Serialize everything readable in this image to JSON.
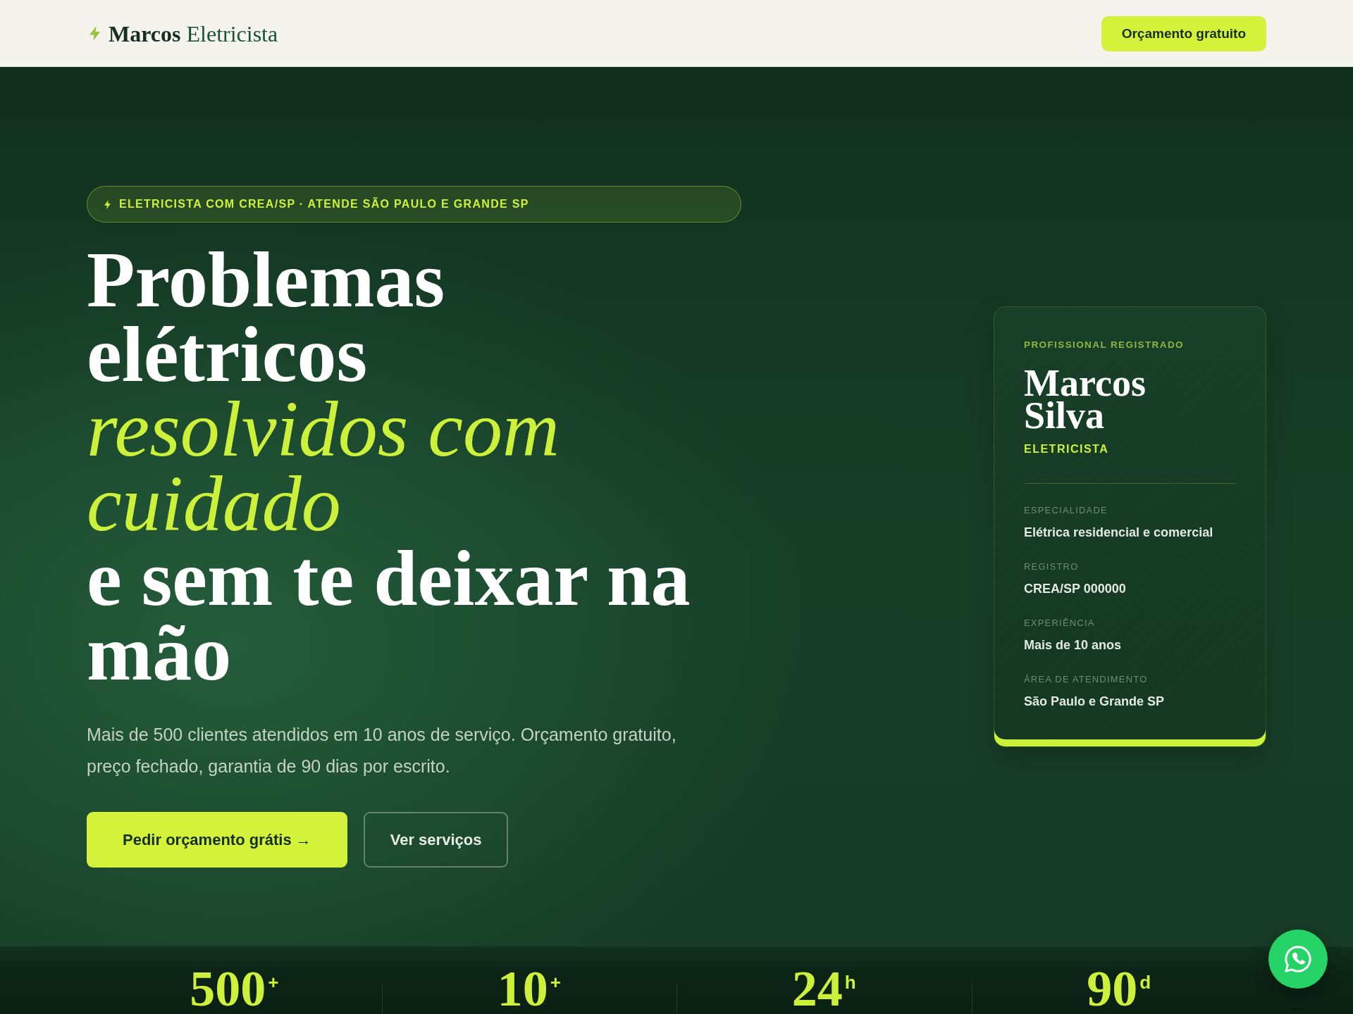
{
  "header": {
    "logo": {
      "first": "Marcos",
      "second": "Eletricista"
    },
    "cta": "Orçamento gratuito"
  },
  "hero": {
    "badge": "ELETRICISTA COM CREA/SP · ATENDE SÃO PAULO E GRANDE SP",
    "heading": "Problemas elétricos *resolvidos com cuidado* e sem te deixar na mão",
    "description": "Mais de 500 clientes atendidos em 10 anos de serviço. Orçamento gratuito, preço fechado, garantia de 90 dias por escrito.",
    "buttons": [
      {
        "label": "Pedir orçamento grátis →",
        "kind": "primary"
      },
      {
        "label": "Ver serviços",
        "kind": "outline"
      }
    ]
  },
  "profile_card": {
    "eyebrow": "PROFISSIONAL REGISTRADO",
    "name": "Marcos Silva",
    "role": "ELETRICISTA",
    "details": [
      {
        "label": "ESPECIALIDADE",
        "value": "Elétrica residencial e comercial"
      },
      {
        "label": "REGISTRO",
        "value": "CREA/SP 000000"
      },
      {
        "label": "EXPERIÊNCIA",
        "value": "Mais de 10 anos"
      },
      {
        "label": "ÁREA DE ATENDIMENTO",
        "value": "São Paulo e Grande SP"
      }
    ]
  },
  "stats": [
    {
      "value": "500",
      "suffix": "+"
    },
    {
      "value": "10",
      "suffix": "+"
    },
    {
      "value": "24",
      "suffix": "h"
    },
    {
      "value": "90",
      "suffix": "d"
    }
  ]
}
